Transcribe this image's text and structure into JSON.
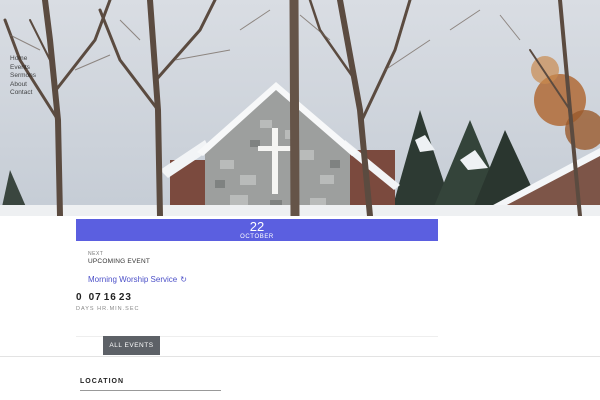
{
  "nav": {
    "items": [
      "Home",
      "Events",
      "Sermons",
      "About",
      "Contact"
    ]
  },
  "event": {
    "day": "22",
    "month": "OCTOBER",
    "next_label": "NEXT",
    "upcoming_label": "UPCOMING EVENT",
    "title": "Morning Worship Service"
  },
  "countdown": {
    "days": "0",
    "hours": "07",
    "minutes": "16",
    "seconds": "23",
    "labels": "DAYS  HR.MIN.SEC"
  },
  "buttons": {
    "all_events": "ALL EVENTS"
  },
  "sections": {
    "location": "LOCATION"
  },
  "colors": {
    "accent": "#5b5fe0",
    "button": "#5d6167",
    "link": "#4c50c8"
  },
  "icons": {
    "event_link": "refresh-icon"
  }
}
